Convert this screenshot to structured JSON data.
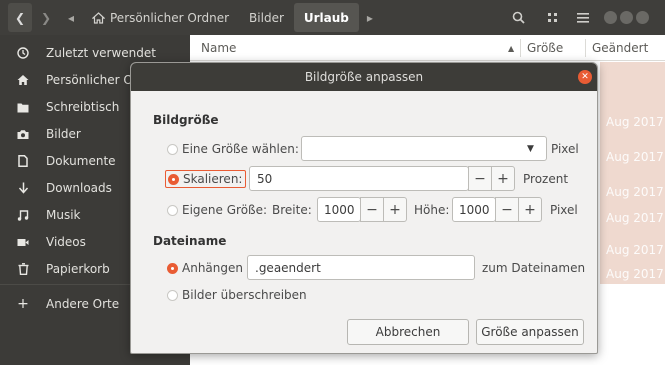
{
  "header": {
    "back_icon": "chevron-left",
    "forward_icon": "chevron-right",
    "breadcrumbs": [
      "Persönlicher Ordner",
      "Bilder",
      "Urlaub"
    ],
    "search_icon": "search",
    "view_icon": "grid",
    "menu_icon": "hamburger"
  },
  "sidebar": {
    "items": [
      {
        "label": "Zuletzt verwendet",
        "icon": "clock-icon"
      },
      {
        "label": "Persönlicher O",
        "icon": "home-icon"
      },
      {
        "label": "Schreibtisch",
        "icon": "folder-icon"
      },
      {
        "label": "Bilder",
        "icon": "camera-icon"
      },
      {
        "label": "Dokumente",
        "icon": "document-icon"
      },
      {
        "label": "Downloads",
        "icon": "download-icon"
      },
      {
        "label": "Musik",
        "icon": "music-icon"
      },
      {
        "label": "Videos",
        "icon": "video-icon"
      },
      {
        "label": "Papierkorb",
        "icon": "trash-icon"
      },
      {
        "label": "Andere Orte",
        "icon": "plus-icon"
      }
    ]
  },
  "files": {
    "columns": {
      "name": "Name",
      "size": "Größe",
      "modified": "Geändert"
    },
    "dates": [
      "Aug 2017",
      "Aug 2017",
      "Aug 2017",
      "Aug 2017",
      "Aug 2017",
      "Aug 2017"
    ]
  },
  "dialog": {
    "title": "Bildgröße anpassen",
    "size_section": "Bildgröße",
    "preset_label": "Eine Größe wählen:",
    "preset_value": "",
    "preset_unit": "Pixel",
    "scale_label": "Skalieren:",
    "scale_value": "50",
    "scale_unit": "Prozent",
    "custom_label": "Eigene Größe:",
    "width_label": "Breite:",
    "width_value": "1000",
    "height_label": "Höhe:",
    "height_value": "1000",
    "custom_unit": "Pixel",
    "filename_section": "Dateiname",
    "append_label": "Anhängen",
    "append_value": ".geaendert",
    "append_suffix": "zum Dateinamen",
    "overwrite_label": "Bilder überschreiben",
    "cancel_label": "Abbrechen",
    "ok_label": "Größe anpassen",
    "minus": "−",
    "plus": "+",
    "accent_color": "#e95c34",
    "selected_size_mode": "Skalieren",
    "selected_name_mode": "Anhängen"
  }
}
